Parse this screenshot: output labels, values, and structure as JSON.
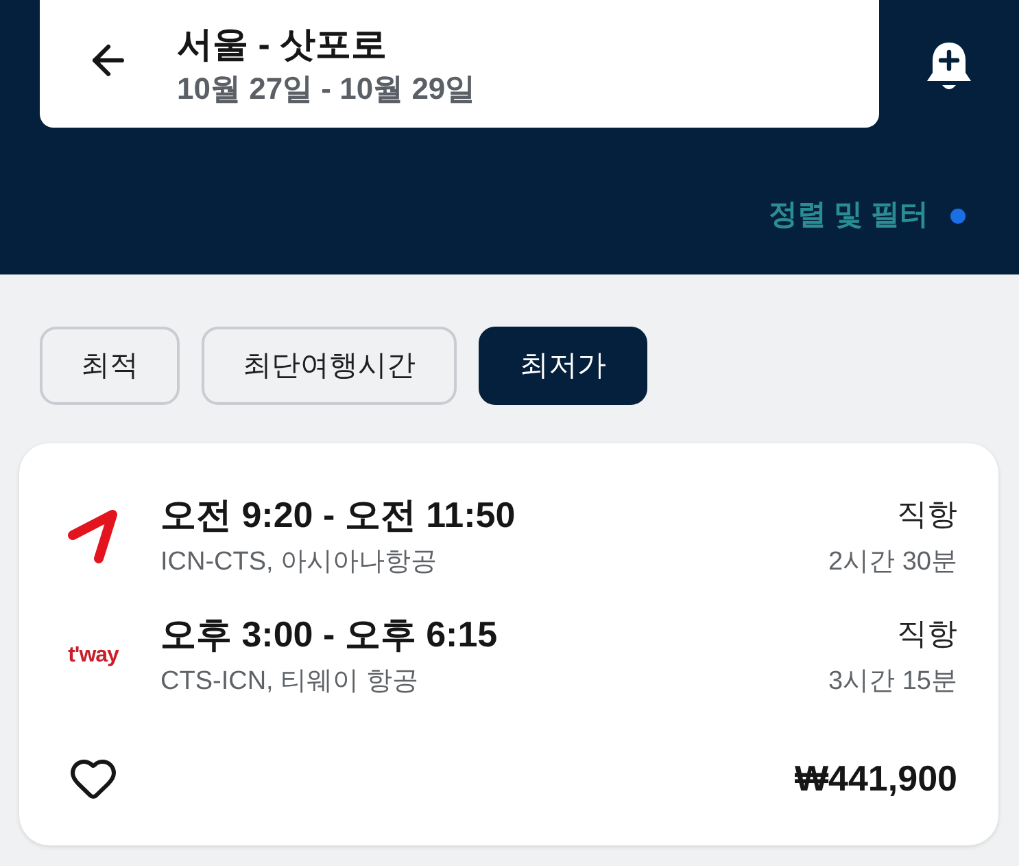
{
  "header": {
    "title": "서울 - 삿포로",
    "dates": "10월 27일 - 10월 29일"
  },
  "filter": {
    "label": "정렬 및 필터",
    "active": true
  },
  "sort_tabs": [
    {
      "label": "최적",
      "selected": false
    },
    {
      "label": "최단여행시간",
      "selected": false
    },
    {
      "label": "최저가",
      "selected": true
    }
  ],
  "results": [
    {
      "legs": [
        {
          "logo": {
            "kind": "mark"
          },
          "times": "오전 9:20 - 오전 11:50",
          "route": "ICN-CTS, 아시아나항공",
          "stops": "직항",
          "duration": "2시간 30분"
        },
        {
          "logo": {
            "kind": "wordmark",
            "text": "t'way"
          },
          "times": "오후 3:00 - 오후 6:15",
          "route": "CTS-ICN, 티웨이 항공",
          "stops": "직항",
          "duration": "3시간 15분"
        }
      ],
      "price": "₩441,900",
      "saved": false
    }
  ]
}
